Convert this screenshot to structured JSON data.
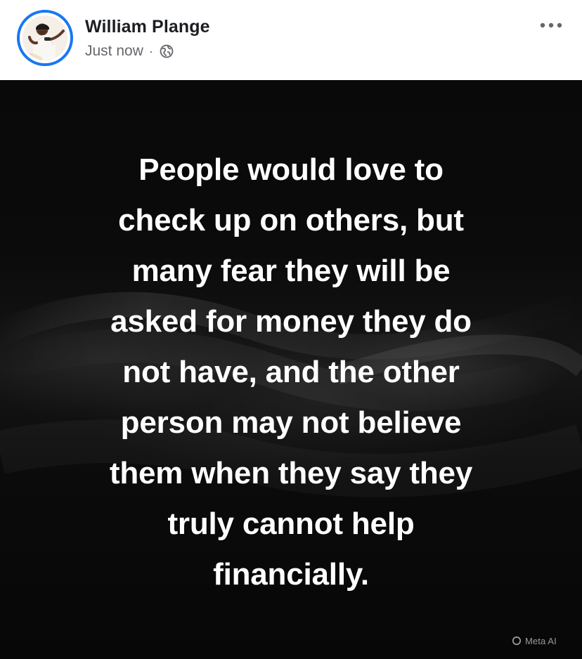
{
  "post": {
    "author": {
      "name": "William Plange",
      "avatar_icon": "user-avatar-photo"
    },
    "meta": {
      "timestamp": "Just now",
      "separator": "·",
      "audience_icon": "globe-icon"
    },
    "actions": {
      "more_icon": "more-options-icon"
    },
    "quote": {
      "text": "People would love to\ncheck up on others, but\nmany fear they will be\nasked for money they do\nnot have, and the other\nperson may not believe\nthem when they say they\ntruly cannot help\nfinancially."
    },
    "badge": {
      "label": "Meta AI",
      "icon": "meta-ai-ring-icon"
    },
    "colors": {
      "accent": "#1877f2",
      "name_text": "#1c1e21",
      "meta_text": "#65676b",
      "card_background": "#0b0b0b",
      "quote_text": "#ffffff"
    }
  }
}
